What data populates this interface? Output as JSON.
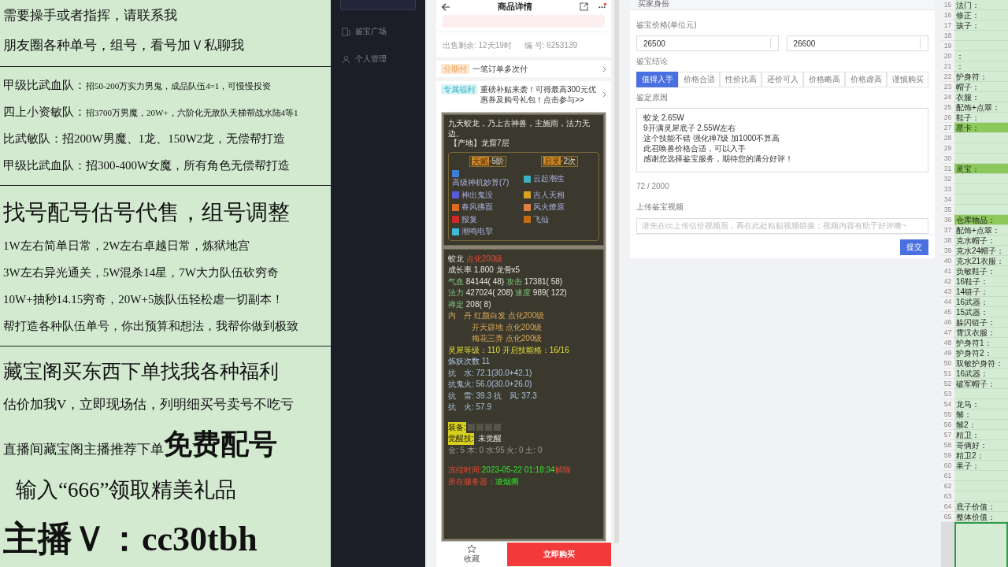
{
  "promo_panel": {
    "lines": [
      {
        "kind": "line",
        "text": "需要操手或者指挥，请联系我"
      },
      {
        "kind": "line",
        "text": "朋友圈各种单号，组号，看号加Ｖ私聊我"
      },
      {
        "kind": "rule"
      },
      {
        "kind": "recruit",
        "lead": "甲级比武血队：",
        "text": "招50-200万实力男鬼，成品队伍4=1，可慢慢投资"
      },
      {
        "kind": "recruit",
        "lead": "四上小资敏队：",
        "text": "招3700万男魔，20W+，六阶化无敌队天梯帮战水陆4等1"
      },
      {
        "kind": "small",
        "text": "比武敏队：招200W男魔、1龙、150W2龙，无偿帮打造"
      },
      {
        "kind": "small",
        "text": "甲级比武血队：招300-400W女魔，所有角色无偿帮打造"
      },
      {
        "kind": "rule"
      },
      {
        "kind": "heading",
        "text": "找号配号估号代售，组号调整"
      },
      {
        "kind": "small",
        "text": "1W左右简单日常，2W左右卓越日常，炼狱地宫"
      },
      {
        "kind": "small",
        "text": "3W左右异光通关，5W混杀14星，7W大力队伍砍穷奇"
      },
      {
        "kind": "small",
        "text": "10W+抽秒14.15穷奇，20W+5族队伍轻松虐一切副本！"
      },
      {
        "kind": "small",
        "text": "帮打造各种队伍单号，你出预算和想法，我帮你做到极致"
      },
      {
        "kind": "rule"
      },
      {
        "kind": "promo",
        "text": "藏宝阁买东西下单找我各种福利"
      },
      {
        "kind": "line",
        "text": "估价加我V，立即现场估，列明细买号卖号不吃亏"
      },
      {
        "kind": "mixed",
        "text": "直播间藏宝阁主播推荐下单",
        "emphasis": "免费配号"
      },
      {
        "kind": "gift",
        "text": "输入“666”领取精美礼品"
      },
      {
        "kind": "contact",
        "text": "主播Ｖ：cc30tbh"
      }
    ]
  },
  "sidebar": {
    "items": [
      {
        "label": "鉴宝广场",
        "kind": "square"
      },
      {
        "label": "个人管理",
        "kind": "person"
      }
    ]
  },
  "phone": {
    "title": "商品详情",
    "info": [
      {
        "text": "出售剩余: 12天19时"
      },
      {
        "text": "编 号: 6253139"
      }
    ],
    "offers": [
      {
        "tag": "分期付",
        "kind": "orange",
        "text": "一笔订单多次付"
      },
      {
        "tag": "专属福利",
        "kind": "cyan",
        "text": "重磅补贴来袭！可得最高300元优惠券及购号礼包！点击参与>>"
      }
    ],
    "pet_card": {
      "description": "九天蛟龙，乃上古神兽，主施雨，法力无边。",
      "origin": "【产地】龙窟7层",
      "badges": [
        {
          "label": "天赋",
          "value": "·5阶"
        },
        {
          "label": "启灵",
          "value": "·2次"
        }
      ],
      "skills": [
        {
          "name": "高级神机妙算(7)",
          "color": "#3a7fd8"
        },
        {
          "name": "云起潮生",
          "color": "#3ab0c0"
        },
        {
          "name": "神出鬼没",
          "color": "#5a5ad8"
        },
        {
          "name": "吉人天相",
          "color": "#d8a020"
        },
        {
          "name": "春风拂面",
          "color": "#e06a20"
        },
        {
          "name": "风火燎原",
          "color": "#e08040"
        },
        {
          "name": "报复",
          "color": "#d02828"
        },
        {
          "name": "飞仙",
          "color": "#c86a10"
        },
        {
          "name": "潮鸣电掣",
          "color": "#40b8d8"
        }
      ]
    },
    "stats_card": {
      "lines": [
        {
          "kind": "text",
          "segments": [
            {
              "text": "蛟龙 ",
              "kind": "plain"
            },
            {
              "text": "点化200级",
              "kind": "alert"
            }
          ]
        },
        {
          "kind": "text",
          "segments": [
            {
              "text": "成长率 1.800 龙骨x5",
              "kind": "plain"
            }
          ]
        },
        {
          "kind": "text",
          "segments": [
            {
              "text": "气血 ",
              "kind": "stat"
            },
            {
              "text": "84144( 48) ",
              "kind": "plain"
            },
            {
              "text": "攻击 ",
              "kind": "stat"
            },
            {
              "text": "17381( 58)",
              "kind": "plain"
            }
          ]
        },
        {
          "kind": "text",
          "segments": [
            {
              "text": "法力 ",
              "kind": "stat"
            },
            {
              "text": "427024( 208) ",
              "kind": "plain"
            },
            {
              "text": "速度 ",
              "kind": "stat"
            },
            {
              "text": "989( 122)",
              "kind": "plain"
            }
          ]
        },
        {
          "kind": "text",
          "segments": [
            {
              "text": "禅定 ",
              "kind": "stat"
            },
            {
              "text": "208( 8)",
              "kind": "plain"
            }
          ]
        },
        {
          "kind": "text",
          "segments": [
            {
              "text": "内　丹 ",
              "kind": "core"
            },
            {
              "text": "红颜白发 点化200级",
              "kind": "core"
            }
          ]
        },
        {
          "kind": "indent",
          "segments": [
            {
              "text": "开天辟地 点化200级",
              "kind": "core"
            }
          ]
        },
        {
          "kind": "indent",
          "segments": [
            {
              "text": "梅花三弄 点化200级",
              "kind": "core"
            }
          ]
        },
        {
          "kind": "text",
          "segments": [
            {
              "text": "灵犀等级：110 开启技能格：16/16",
              "kind": "level"
            }
          ]
        },
        {
          "kind": "text",
          "segments": [
            {
              "text": "炼妖次数 11",
              "kind": "resist"
            }
          ]
        },
        {
          "kind": "text",
          "segments": [
            {
              "text": "抗　水: 72.1(30.0+42.1)",
              "kind": "resist"
            }
          ]
        },
        {
          "kind": "text",
          "segments": [
            {
              "text": "抗鬼火: 56.0(30.0+26.0)",
              "kind": "resist"
            }
          ]
        },
        {
          "kind": "text",
          "segments": [
            {
              "text": "抗　雷: 39.3 抗　风: 37.3",
              "kind": "resist"
            }
          ]
        },
        {
          "kind": "text",
          "segments": [
            {
              "text": "抗　火: 57.9",
              "kind": "resist"
            }
          ]
        },
        {
          "kind": "gap"
        },
        {
          "kind": "equipment",
          "segments": [
            {
              "text": "装备:",
              "kind": "label"
            }
          ]
        },
        {
          "kind": "text",
          "segments": [
            {
              "text": "觉醒技:",
              "kind": "label"
            },
            {
              "text": "  未觉醒",
              "kind": "plain"
            }
          ]
        },
        {
          "kind": "text",
          "segments": [
            {
              "text": "金: 5 木: 0 水:95 火: 0 土: 0",
              "kind": "muted"
            }
          ]
        },
        {
          "kind": "gap"
        },
        {
          "kind": "text",
          "segments": [
            {
              "text": "冻结时间:",
              "kind": "alert"
            },
            {
              "text": "2023-05-22 01:18:34",
              "kind": "time"
            },
            {
              "text": "解除",
              "kind": "alert"
            }
          ]
        },
        {
          "kind": "text",
          "segments": [
            {
              "text": "所在服务器：",
              "kind": "alert"
            },
            {
              "text": "凌烟阁",
              "kind": "time"
            }
          ]
        }
      ]
    },
    "favorite_label": "收藏",
    "buy_button": "立即购买"
  },
  "appraisal_form": {
    "section": "买家身份",
    "price_label": "鉴宝价格(单位元)",
    "prices": [
      "26500",
      "26600"
    ],
    "conclusion_label": "鉴宝结论",
    "conclusions": [
      {
        "label": "值得入手",
        "selected": true
      },
      {
        "label": "价格合适",
        "selected": false
      },
      {
        "label": "性价比高",
        "selected": false
      },
      {
        "label": "还价可入",
        "selected": false
      },
      {
        "label": "价格略高",
        "selected": false
      },
      {
        "label": "价格虚高",
        "selected": false
      },
      {
        "label": "谨慎购买",
        "selected": false
      }
    ],
    "reason_label": "鉴定原因",
    "reason_lines": [
      "蛟龙 2.65W",
      "9开满灵犀底子 2.55W左右",
      "这个技能不错 强化禅7级 加1000不算高",
      "此召唤兽价格合适，可以入手",
      "感谢您选择鉴宝服务，期待您的满分好评！"
    ],
    "counter": "72 / 2000",
    "video_label": "上传鉴宝视频",
    "video_placeholder": "请先在cc上传估价视频后，再在此处粘贴视频链接；视频内容有助于好评噢~",
    "submit": "提交"
  },
  "sheet": {
    "rows": [
      {
        "number": "15",
        "label": "法门：",
        "highlighted": false
      },
      {
        "number": "16",
        "label": "修正：",
        "highlighted": false
      },
      {
        "number": "17",
        "label": "孩子：",
        "highlighted": false
      },
      {
        "number": "18",
        "highlighted": false
      },
      {
        "number": "19",
        "highlighted": false
      },
      {
        "number": "20",
        "label": "：",
        "highlighted": false
      },
      {
        "number": "21",
        "label": "：",
        "highlighted": false
      },
      {
        "number": "22",
        "label": "护身符：",
        "highlighted": false
      },
      {
        "number": "23",
        "label": "帽子：",
        "highlighted": false
      },
      {
        "number": "24",
        "label": "衣服：",
        "highlighted": false
      },
      {
        "number": "25",
        "label": "配饰+点翠：",
        "highlighted": false
      },
      {
        "number": "26",
        "label": "鞋子：",
        "highlighted": false
      },
      {
        "number": "27",
        "label": "星卡：",
        "highlighted": true
      },
      {
        "number": "28",
        "highlighted": false
      },
      {
        "number": "29",
        "highlighted": false
      },
      {
        "number": "30",
        "highlighted": false
      },
      {
        "number": "31",
        "label": "灵宝：",
        "highlighted": true
      },
      {
        "number": "32",
        "highlighted": false
      },
      {
        "number": "33",
        "highlighted": false
      },
      {
        "number": "34",
        "highlighted": false
      },
      {
        "number": "35",
        "highlighted": false
      },
      {
        "number": "36",
        "label": "仓库物品：",
        "highlighted": true
      },
      {
        "number": "37",
        "label": "配饰+点翠：",
        "highlighted": false
      },
      {
        "number": "38",
        "label": "克水帽子：",
        "highlighted": false
      },
      {
        "number": "39",
        "label": "克水24帽子：",
        "highlighted": false
      },
      {
        "number": "40",
        "label": "克水21衣服：",
        "highlighted": false
      },
      {
        "number": "41",
        "label": "负敏鞋子：",
        "highlighted": false
      },
      {
        "number": "42",
        "label": "16鞋子：",
        "highlighted": false
      },
      {
        "number": "43",
        "label": "14链子：",
        "highlighted": false
      },
      {
        "number": "44",
        "label": "16武器：",
        "highlighted": false
      },
      {
        "number": "45",
        "label": "15武器：",
        "highlighted": false
      },
      {
        "number": "46",
        "label": "躲闪链子：",
        "highlighted": false
      },
      {
        "number": "47",
        "label": "霄汉衣服：",
        "highlighted": false
      },
      {
        "number": "48",
        "label": "护身符1：",
        "highlighted": false
      },
      {
        "number": "49",
        "label": "护身符2：",
        "highlighted": false
      },
      {
        "number": "50",
        "label": "双敏护身符：",
        "highlighted": false
      },
      {
        "number": "51",
        "label": "16武器：",
        "highlighted": false
      },
      {
        "number": "52",
        "label": "破军帽子：",
        "highlighted": false
      },
      {
        "number": "53",
        "highlighted": false
      },
      {
        "number": "54",
        "label": "龙马：",
        "highlighted": false
      },
      {
        "number": "55",
        "label": "鬃：",
        "highlighted": false
      },
      {
        "number": "56",
        "label": "鬃2：",
        "highlighted": false
      },
      {
        "number": "57",
        "label": "精卫：",
        "highlighted": false
      },
      {
        "number": "58",
        "label": "哥俩好：",
        "highlighted": false
      },
      {
        "number": "59",
        "label": "精卫2：",
        "highlighted": false
      },
      {
        "number": "60",
        "label": "果子：",
        "highlighted": false
      },
      {
        "number": "61",
        "highlighted": false
      },
      {
        "number": "62",
        "highlighted": false
      },
      {
        "number": "63",
        "highlighted": false
      },
      {
        "number": "64",
        "label": "底子价值：",
        "highlighted": false
      },
      {
        "number": "65",
        "label": "整体价值：",
        "highlighted": false
      }
    ]
  }
}
